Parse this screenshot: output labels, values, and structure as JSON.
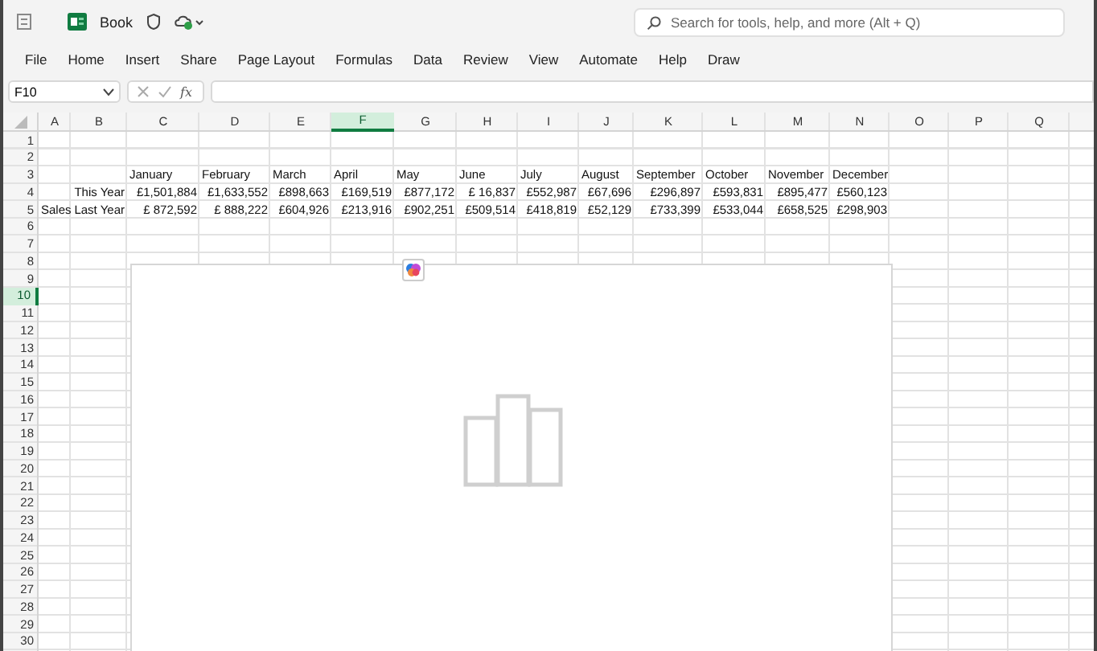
{
  "title_bar": {
    "document_title": "Book",
    "search": {
      "placeholder": "Search for tools, help, and more (Alt + Q)"
    }
  },
  "ribbon_tabs": [
    "File",
    "Home",
    "Insert",
    "Share",
    "Page Layout",
    "Formulas",
    "Data",
    "Review",
    "View",
    "Automate",
    "Help",
    "Draw"
  ],
  "formula_bar": {
    "name_box": "F10",
    "function_label": "fx"
  },
  "sheet": {
    "column_headers": [
      {
        "label": "A",
        "selected": false
      },
      {
        "label": "B",
        "selected": false
      },
      {
        "label": "C",
        "selected": false
      },
      {
        "label": "D",
        "selected": false
      },
      {
        "label": "E",
        "selected": false
      },
      {
        "label": "F",
        "selected": true
      },
      {
        "label": "G",
        "selected": false
      },
      {
        "label": "H",
        "selected": false
      },
      {
        "label": "I",
        "selected": false
      },
      {
        "label": "J",
        "selected": false
      },
      {
        "label": "K",
        "selected": false
      },
      {
        "label": "L",
        "selected": false
      },
      {
        "label": "M",
        "selected": false
      },
      {
        "label": "N",
        "selected": false
      },
      {
        "label": "O",
        "selected": false
      },
      {
        "label": "P",
        "selected": false
      },
      {
        "label": "Q",
        "selected": false
      }
    ],
    "row_headers": [
      {
        "label": "1",
        "selected": false
      },
      {
        "label": "2",
        "selected": false
      },
      {
        "label": "3",
        "selected": false
      },
      {
        "label": "4",
        "selected": false
      },
      {
        "label": "5",
        "selected": false
      },
      {
        "label": "6",
        "selected": false
      },
      {
        "label": "7",
        "selected": false
      },
      {
        "label": "8",
        "selected": false
      },
      {
        "label": "9",
        "selected": false
      },
      {
        "label": "10",
        "selected": true
      },
      {
        "label": "11",
        "selected": false
      },
      {
        "label": "12",
        "selected": false
      },
      {
        "label": "13",
        "selected": false
      },
      {
        "label": "14",
        "selected": false
      },
      {
        "label": "15",
        "selected": false
      },
      {
        "label": "16",
        "selected": false
      },
      {
        "label": "17",
        "selected": false
      },
      {
        "label": "18",
        "selected": false
      },
      {
        "label": "19",
        "selected": false
      },
      {
        "label": "20",
        "selected": false
      },
      {
        "label": "21",
        "selected": false
      },
      {
        "label": "22",
        "selected": false
      },
      {
        "label": "23",
        "selected": false
      },
      {
        "label": "24",
        "selected": false
      },
      {
        "label": "25",
        "selected": false
      },
      {
        "label": "26",
        "selected": false
      },
      {
        "label": "27",
        "selected": false
      },
      {
        "label": "28",
        "selected": false
      },
      {
        "label": "29",
        "selected": false
      },
      {
        "label": "30",
        "selected": false
      }
    ],
    "months": [
      "January",
      "February",
      "March",
      "April",
      "May",
      "June",
      "July",
      "August",
      "September",
      "October",
      "November",
      "December"
    ],
    "group_label": "Sales",
    "series": [
      {
        "label": "This Year",
        "values": [
          "£1,501,884",
          "£1,633,552",
          "£898,663",
          "£169,519",
          "£877,172",
          "£ 16,837",
          "£552,987",
          "£67,696",
          "£296,897",
          "£593,831",
          "£895,477",
          "£560,123"
        ]
      },
      {
        "label": "Last Year",
        "values": [
          "£ 872,592",
          "£ 888,222",
          "£604,926",
          "£213,916",
          "£902,251",
          "£509,514",
          "£418,819",
          "£52,129",
          "£733,399",
          "£533,044",
          "£658,525",
          "£298,903"
        ]
      }
    ]
  }
}
